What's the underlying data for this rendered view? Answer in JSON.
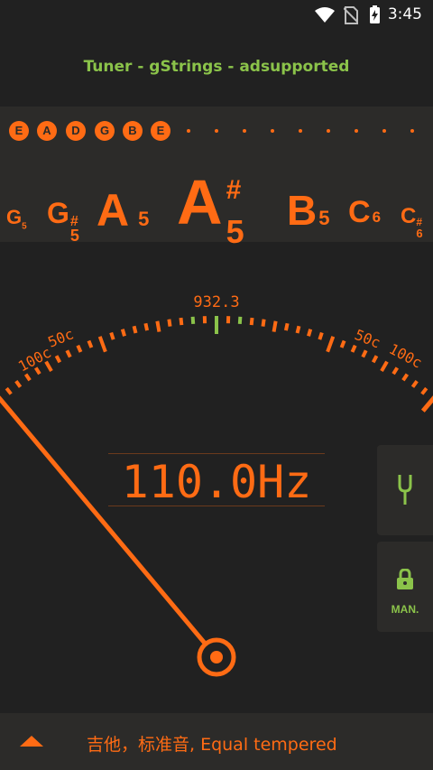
{
  "status_bar": {
    "time": "3:45"
  },
  "app": {
    "title": "Tuner - gStrings - adsupported"
  },
  "strings": [
    "E",
    "A",
    "D",
    "G",
    "B",
    "E"
  ],
  "notes": [
    {
      "letter": "G",
      "accidental": "",
      "octave": "5"
    },
    {
      "letter": "G",
      "accidental": "#",
      "octave": "5"
    },
    {
      "letter": "A",
      "accidental": "",
      "octave": "5"
    },
    {
      "letter": "A",
      "accidental": "#",
      "octave": "5"
    },
    {
      "letter": "B",
      "accidental": "",
      "octave": "5"
    },
    {
      "letter": "C",
      "accidental": "",
      "octave": "6"
    },
    {
      "letter": "C",
      "accidental": "#",
      "octave": "6"
    }
  ],
  "meter": {
    "target_freq": "932.3",
    "labels": {
      "left_100": "100c",
      "left_50": "50c",
      "right_50": "50c",
      "right_100": "100c"
    },
    "needle_cents": -100
  },
  "frequency": "110.0Hz",
  "side": {
    "manual_label": "MAN."
  },
  "bottom": {
    "tuning": "吉他，标准音, Equal tempered"
  },
  "colors": {
    "accent": "#ff6b14",
    "green": "#8bc34a",
    "bg": "#212121",
    "panel": "#2c2b29"
  }
}
